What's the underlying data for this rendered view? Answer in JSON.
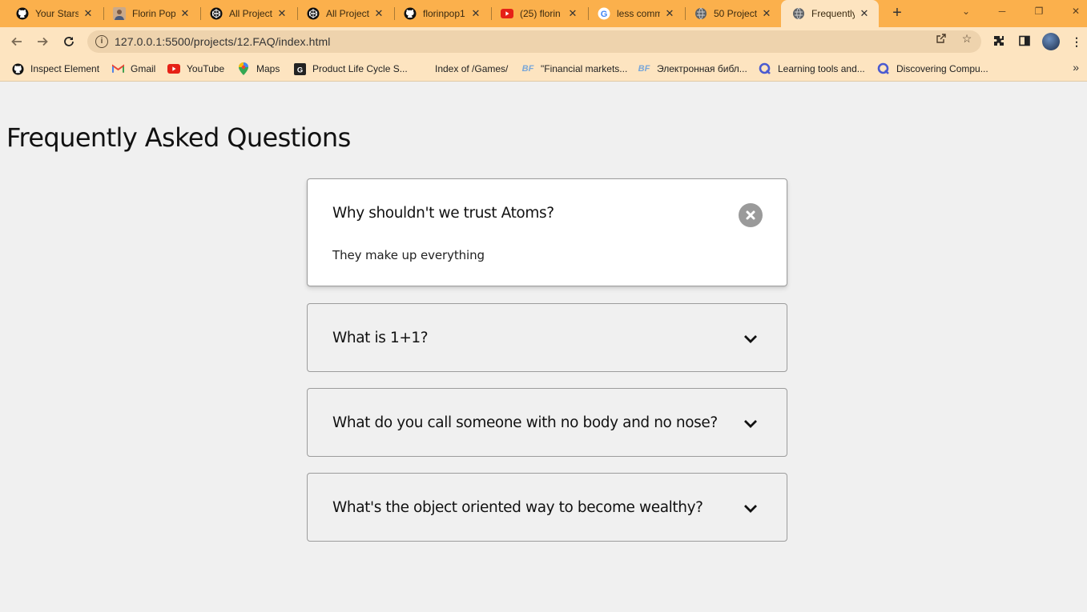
{
  "browser": {
    "tabs": [
      {
        "title": "Your Stars",
        "icon": "github-icon"
      },
      {
        "title": "Florin Pop",
        "icon": "avatar-icon"
      },
      {
        "title": "All Projects",
        "icon": "codepen-icon"
      },
      {
        "title": "All Projects",
        "icon": "codepen-icon"
      },
      {
        "title": "florinpop1",
        "icon": "github-icon"
      },
      {
        "title": "(25) florin",
        "icon": "youtube-icon"
      },
      {
        "title": "less comm",
        "icon": "google-icon"
      },
      {
        "title": "50 Projects",
        "icon": "globe-icon"
      },
      {
        "title": "Frequently",
        "icon": "globe-icon"
      }
    ],
    "url": "127.0.0.1:5500/projects/12.FAQ/index.html",
    "bookmarks": [
      {
        "label": "Inspect Element",
        "icon": "github-icon"
      },
      {
        "label": "Gmail",
        "icon": "gmail-icon"
      },
      {
        "label": "YouTube",
        "icon": "youtube-icon"
      },
      {
        "label": "Maps",
        "icon": "maps-icon"
      },
      {
        "label": "Product Life Cycle S...",
        "icon": "generic-g-icon"
      },
      {
        "label": "Index of /Games/",
        "icon": "none"
      },
      {
        "label": "\"Financial markets...",
        "icon": "bf-icon"
      },
      {
        "label": "Электронная библ...",
        "icon": "bf-icon"
      },
      {
        "label": "Learning tools and...",
        "icon": "q-icon"
      },
      {
        "label": "Discovering Compu...",
        "icon": "q-icon"
      }
    ],
    "colors": {
      "tabstrip": "#fbb04c",
      "toolbar": "#fde4c0",
      "omnibox": "#eed3ad"
    }
  },
  "page": {
    "title": "Frequently Asked Questions",
    "faqs": [
      {
        "question": "Why shouldn't we trust Atoms?",
        "answer": "They make up everything",
        "open": true
      },
      {
        "question": "What is 1+1?",
        "open": false
      },
      {
        "question": "What do you call someone with no body and no nose?",
        "open": false
      },
      {
        "question": "What's the object oriented way to become wealthy?",
        "open": false
      }
    ]
  }
}
